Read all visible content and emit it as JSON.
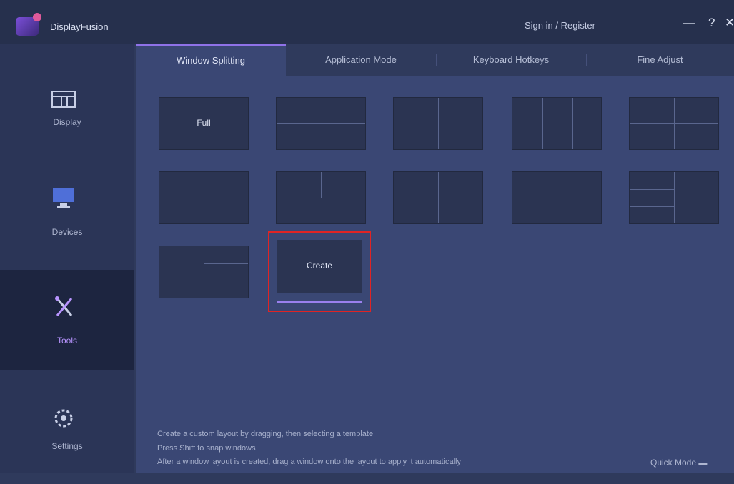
{
  "app": {
    "title": "DisplayFusion",
    "signin": "Sign in / Register"
  },
  "window": {
    "minimize": "—",
    "help": "?",
    "close": "✕"
  },
  "sidebar": {
    "items": [
      {
        "label": "Display",
        "icon": "monitor-grid-icon"
      },
      {
        "label": "Devices",
        "icon": "monitor-icon"
      },
      {
        "label": "Tools",
        "icon": "tools-icon"
      },
      {
        "label": "Settings",
        "icon": "gear-icon"
      }
    ],
    "active_index": 2
  },
  "tabs": [
    {
      "label": "Window Splitting"
    },
    {
      "label": "Application Mode"
    },
    {
      "label": "Keyboard Hotkeys"
    },
    {
      "label": "Fine Adjust"
    }
  ],
  "layouts": {
    "full_label": "Full",
    "create_label": "Create"
  },
  "notes": [
    "Create a custom layout by dragging, then selecting a template",
    "Press Shift to snap windows",
    "After a window layout is created, drag a window onto the layout to apply it automatically"
  ],
  "footer": {
    "quick_mode": "Quick Mode ▬"
  },
  "colors": {
    "accent": "#8f72e8",
    "highlight_border": "#e02424",
    "content_bg": "#3a4774"
  }
}
